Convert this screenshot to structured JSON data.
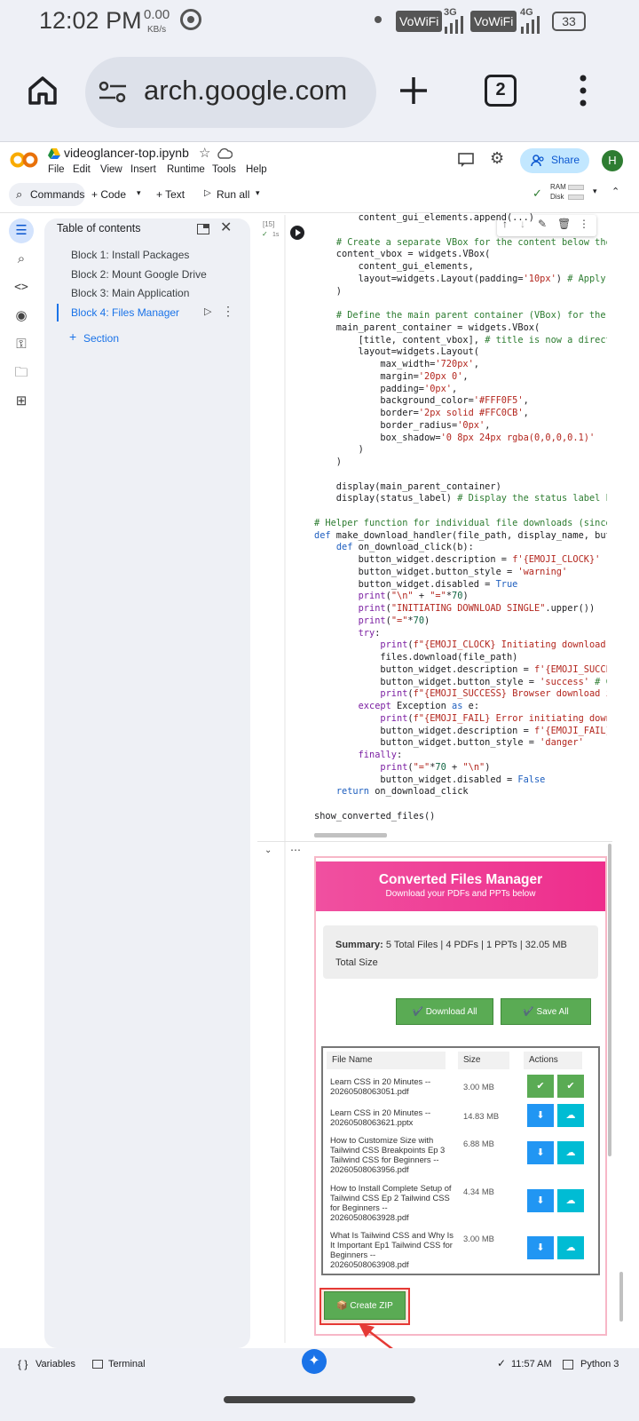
{
  "status_bar": {
    "time": "12:02 PM",
    "net_speed_value": "0.00",
    "net_speed_unit": "KB/s",
    "vowifi1": "VoWiFi",
    "sig1": "3G",
    "vowifi2": "VoWiFi",
    "sig2": "4G",
    "battery": "33"
  },
  "browser": {
    "url": "arch.google.com",
    "tab_count": "2"
  },
  "colab": {
    "notebook_title": "videoglancer-top.ipynb",
    "menu": [
      "File",
      "Edit",
      "View",
      "Insert",
      "Runtime",
      "Tools",
      "Help"
    ],
    "share_label": "Share",
    "avatar_letter": "H",
    "toolbar": {
      "commands": "Commands",
      "code": "+ Code",
      "text": "+ Text",
      "run_all": "Run all",
      "ram": "RAM",
      "disk": "Disk"
    }
  },
  "toc": {
    "title": "Table of contents",
    "items": [
      "Block 1: Install Packages",
      "Block 2: Mount Google Drive",
      "Block 3: Main Application",
      "Block 4: Files Manager"
    ],
    "section_label": "Section"
  },
  "cell": {
    "exec_count": "[15]",
    "exec_time": "1s"
  },
  "output": {
    "banner_title": "Converted Files Manager",
    "banner_subtitle": "Download your PDFs and PPTs below",
    "summary_label": "Summary:",
    "summary_text": " 5 Total Files | 4 PDFs | 1 PPTs | 32.05 MB Total Size",
    "download_all": "✔️ Download All",
    "save_all": "✔️ Save All",
    "col_file": "File Name",
    "col_size": "Size",
    "col_actions": "Actions",
    "files": [
      {
        "name": "Learn CSS in 20 Minutes -- 20260508063051.pdf",
        "size": "3.00 MB",
        "a1": "✔",
        "a2": "✔"
      },
      {
        "name": "Learn CSS in 20 Minutes -- 20260508063621.pptx",
        "size": "14.83 MB",
        "a1": "⬇",
        "a2": "☁"
      },
      {
        "name": "How to Customize Size with Tailwind CSS Breakpoints Ep 3 Tailwind CSS for Beginners -- 20260508063956.pdf",
        "size": "6.88 MB",
        "a1": "⬇",
        "a2": "☁"
      },
      {
        "name": "How to Install Complete Setup of Tailwind CSS Ep 2 Tailwind CSS for Beginners -- 20260508063928.pdf",
        "size": "4.34 MB",
        "a1": "⬇",
        "a2": "☁"
      },
      {
        "name": "What Is Tailwind CSS and Why Is It Important Ep1 Tailwind CSS for Beginners -- 20260508063908.pdf",
        "size": "3.00 MB",
        "a1": "⬇",
        "a2": "☁"
      }
    ],
    "create_zip": "📦 Create ZIP"
  },
  "bottom_bar": {
    "variables": "Variables",
    "terminal": "Terminal",
    "time": "11:57 AM",
    "runtime": "Python 3"
  },
  "colors": {
    "accent_blue": "#1a73e8",
    "banner_pink": "#f050a0",
    "action_green": "#5aab54",
    "action_blue": "#2196f3",
    "action_cyan": "#00bcd4",
    "annotation_red": "#e53935"
  }
}
